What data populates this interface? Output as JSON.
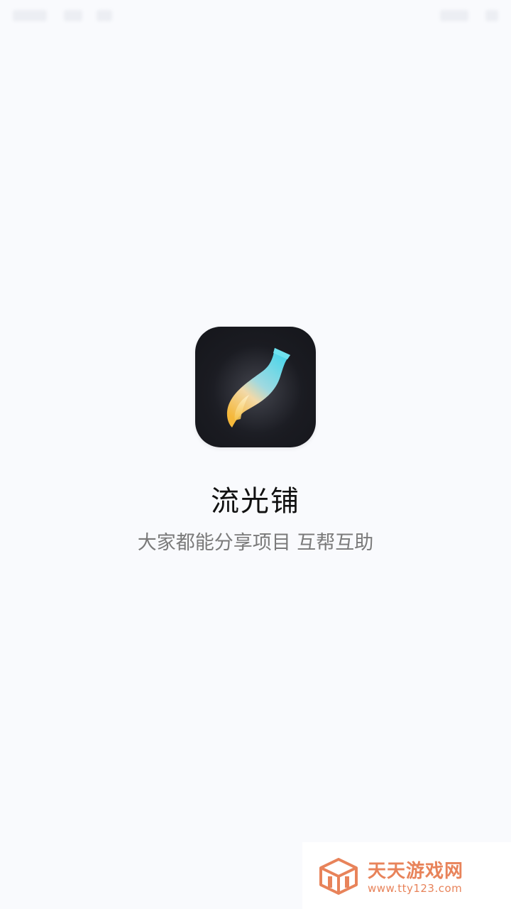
{
  "app": {
    "name": "流光铺",
    "slogan": "大家都能分享项目 互帮互助",
    "icon": "feather-brush-icon"
  },
  "watermark": {
    "title": "天天游戏网",
    "url": "www.tty123.com",
    "icon": "cube-logo-icon"
  },
  "colors": {
    "background": "#f9fafd",
    "icon_bg": "#1a1b21",
    "feather_top": "#5fd8e8",
    "feather_bottom": "#f5c04a",
    "watermark": "#e8835a"
  }
}
